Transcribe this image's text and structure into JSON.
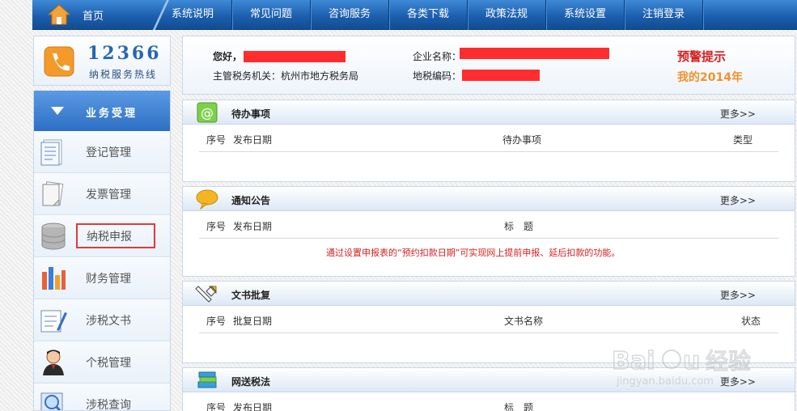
{
  "nav": {
    "home": "首页",
    "items": [
      "系统说明",
      "常见问题",
      "咨询服务",
      "各类下载",
      "政策法规",
      "系统设置",
      "注销登录"
    ]
  },
  "hotline": {
    "number": "12366",
    "label": "纳税服务热线"
  },
  "sidebar": {
    "header": "业务受理",
    "items": [
      {
        "label": "登记管理",
        "icon": "registration-icon"
      },
      {
        "label": "发票管理",
        "icon": "invoice-icon"
      },
      {
        "label": "纳税申报",
        "icon": "database-icon"
      },
      {
        "label": "财务管理",
        "icon": "bar-chart-icon"
      },
      {
        "label": "涉税文书",
        "icon": "document-pen-icon"
      },
      {
        "label": "个税管理",
        "icon": "person-icon"
      },
      {
        "label": "涉税查询",
        "icon": "magnifier-icon"
      }
    ],
    "highlighted": "纳税申报"
  },
  "user": {
    "greeting": "您好，",
    "company_label": "企业名称：",
    "tax_authority": "主管税务机关：杭州市地方税务局",
    "ds_code_label": "地税编码：",
    "warning": "预警提示",
    "my_year": "我的2014年"
  },
  "panels": {
    "todo": {
      "title": "待办事项",
      "more": "更多>>",
      "cols": [
        "序号",
        "发布日期",
        "待办事项",
        "类型"
      ]
    },
    "notice": {
      "title": "通知公告",
      "more": "更多>>",
      "cols": [
        "序号",
        "发布日期",
        "标　题"
      ],
      "message": "通过设置申报表的“预约扣款日期”可实现网上提前申报、延后扣款的功能。"
    },
    "docs": {
      "title": "文书批复",
      "more": "更多>>",
      "cols": [
        "序号",
        "批复日期",
        "文书名称",
        "状态"
      ]
    },
    "tax": {
      "title": "网送税法",
      "more": "更多>>",
      "cols": [
        "序号",
        "发布日期",
        "标　题"
      ]
    }
  },
  "watermark": {
    "logo": "Baidu经验",
    "url": "jingyan.baidu.com"
  },
  "colors": {
    "nav": "#1c5fae",
    "warning": "#d42020",
    "year": "#f0922a",
    "redaction": "#ff2d2d"
  }
}
